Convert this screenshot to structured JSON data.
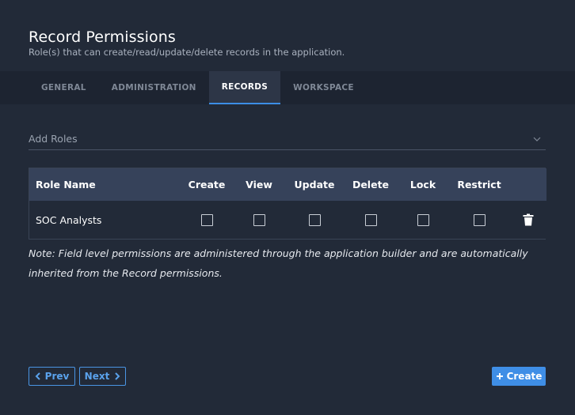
{
  "header": {
    "title": "Record Permissions",
    "subtitle": "Role(s) that can create/read/update/delete records in the application."
  },
  "tabs": [
    {
      "label": "GENERAL",
      "active": false
    },
    {
      "label": "ADMINISTRATION",
      "active": false
    },
    {
      "label": "RECORDS",
      "active": true
    },
    {
      "label": "WORKSPACE",
      "active": false
    }
  ],
  "add_roles": {
    "placeholder": "Add Roles"
  },
  "table": {
    "columns": [
      "Role Name",
      "Create",
      "View",
      "Update",
      "Delete",
      "Lock",
      "Restrict"
    ],
    "rows": [
      {
        "role": "SOC Analysts",
        "create": false,
        "view": false,
        "update": false,
        "delete": false,
        "lock": false,
        "restrict": false
      }
    ]
  },
  "note": "Note: Field level permissions are administered through the application builder and are automatically inherited from the Record permissions.",
  "buttons": {
    "prev": "Prev",
    "next": "Next",
    "create": "Create"
  },
  "icons": {
    "prev": "chevron-left-icon",
    "next": "chevron-right-icon",
    "create": "plus-icon",
    "row_action": "trash-icon",
    "dropdown": "chevron-down-icon"
  },
  "colors": {
    "accent": "#3f8ee6",
    "background": "#222a38",
    "header_row": "#36425a"
  }
}
